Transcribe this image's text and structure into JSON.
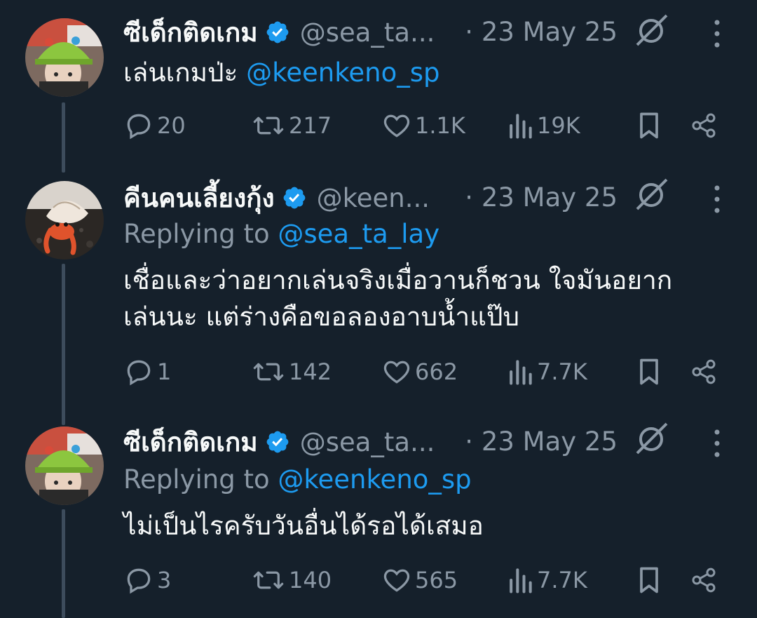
{
  "colors": {
    "background": "#15202b",
    "accent": "#1d9bf0",
    "muted": "#8b98a5",
    "text": "#f7f9f9"
  },
  "tweets": [
    {
      "author_name": "ซีเด็กติดเกม",
      "handle": "@sea_ta...",
      "date": "· 23 May 25",
      "replying_label": "",
      "replying_to": "",
      "text_prefix": "เล่นเกมป่ะ ",
      "text_mention": "@keenkeno_sp",
      "text_lines": [],
      "avatar_icon": "avatar-boy-green-hat",
      "verified_icon": "verified-badge-icon",
      "stats": {
        "replies": "20",
        "retweets": "217",
        "likes": "1.1K",
        "views": "19K"
      }
    },
    {
      "author_name": "คีนคนเลี้ยงกุ้ง",
      "handle": "@keen...",
      "date": "· 23 May 25",
      "replying_label": "Replying to ",
      "replying_to": "@sea_ta_lay",
      "text_prefix": "",
      "text_mention": "",
      "text_lines": [
        "เชื่อและว่าอยากเล่นจริงเมื่อวานก็ชวน ใจมันอยาก",
        "เล่นนะ แต่ร่างคือขอลองอาบน้ำแป๊บ"
      ],
      "avatar_icon": "avatar-hermit-crab",
      "verified_icon": "verified-badge-icon",
      "stats": {
        "replies": "1",
        "retweets": "142",
        "likes": "662",
        "views": "7.7K"
      }
    },
    {
      "author_name": "ซีเด็กติดเกม",
      "handle": "@sea_ta...",
      "date": "· 23 May 25",
      "replying_label": "Replying to ",
      "replying_to": "@keenkeno_sp",
      "text_prefix": "",
      "text_mention": "",
      "text_lines": [
        "ไม่เป็นไรครับวันอื่นได้รอได้เสมอ"
      ],
      "avatar_icon": "avatar-boy-green-hat",
      "verified_icon": "verified-badge-icon",
      "stats": {
        "replies": "3",
        "retweets": "140",
        "likes": "565",
        "views": "7.7K"
      }
    }
  ]
}
